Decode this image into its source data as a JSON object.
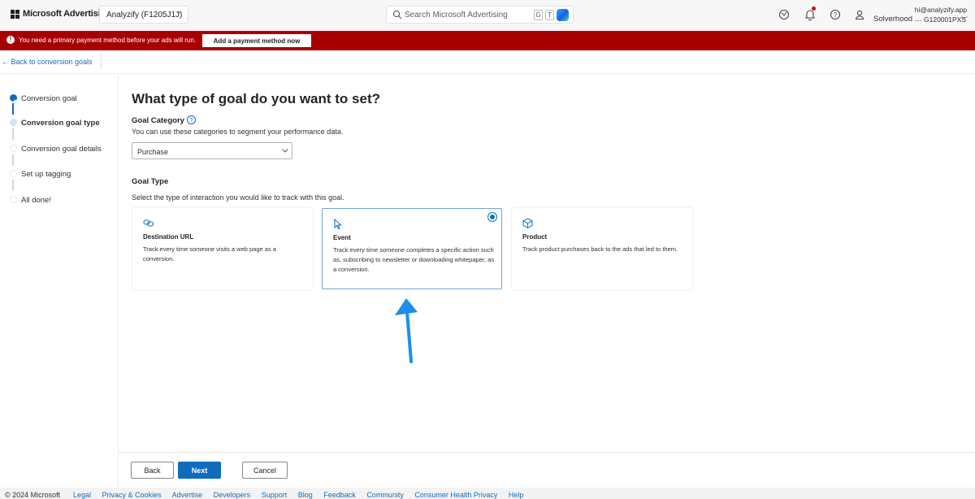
{
  "header": {
    "brand": "Microsoft Advertising",
    "account": "Analyzify (F1205J1J)",
    "search_placeholder": "Search Microsoft Advertising",
    "shortcut_keys": [
      "G",
      "T"
    ],
    "user_email": "hi@analyzify.app",
    "user_org": "Solverhood ...",
    "user_id": "G120001PXS",
    "icons": [
      "network-icon",
      "bell-icon",
      "help-icon",
      "user-icon"
    ]
  },
  "alert": {
    "message": "You need a primary payment method before your ads will run.",
    "action_label": "Add a payment method now"
  },
  "nav": {
    "back_label": "← Back to conversion goals"
  },
  "steps": [
    {
      "label": "Conversion goal",
      "status": "done"
    },
    {
      "label": "Conversion goal type",
      "status": "current"
    },
    {
      "label": "Conversion goal details",
      "status": "todo"
    },
    {
      "label": "Set up tagging",
      "status": "todo"
    },
    {
      "label": "All done!",
      "status": "todo"
    }
  ],
  "main": {
    "title": "What type of goal do you want to set?",
    "category_label": "Goal Category",
    "category_hint": "You can use these categories to segment your performance data.",
    "category_value": "Purchase",
    "type_label": "Goal Type",
    "type_hint": "Select the type of interaction you would like to track with this goal.",
    "cards": [
      {
        "title": "Destination URL",
        "description": "Track every time someone visits a web page as a conversion.",
        "icon": "link-icon",
        "selected": false
      },
      {
        "title": "Event",
        "description": "Track every time someone completes a specific action such as, subscribing to newsletter or downloading whitepaper, as a conversion.",
        "icon": "cursor-icon",
        "selected": true
      },
      {
        "title": "Product",
        "description": "Track product purchases back to the ads that led to them.",
        "icon": "box-icon",
        "selected": false
      }
    ]
  },
  "buttons": {
    "back": "Back",
    "next": "Next",
    "cancel": "Cancel"
  },
  "footer": {
    "copyright": "© 2024 Microsoft",
    "links": [
      "Legal",
      "Privacy & Cookies",
      "Advertise",
      "Developers",
      "Support",
      "Blog",
      "Feedback",
      "Community",
      "Consumer Health Privacy",
      "Help"
    ]
  },
  "colors": {
    "accent": "#0f6cbd",
    "alert_bg": "#a80000",
    "annotation_arrow": "#1e8fe8"
  }
}
